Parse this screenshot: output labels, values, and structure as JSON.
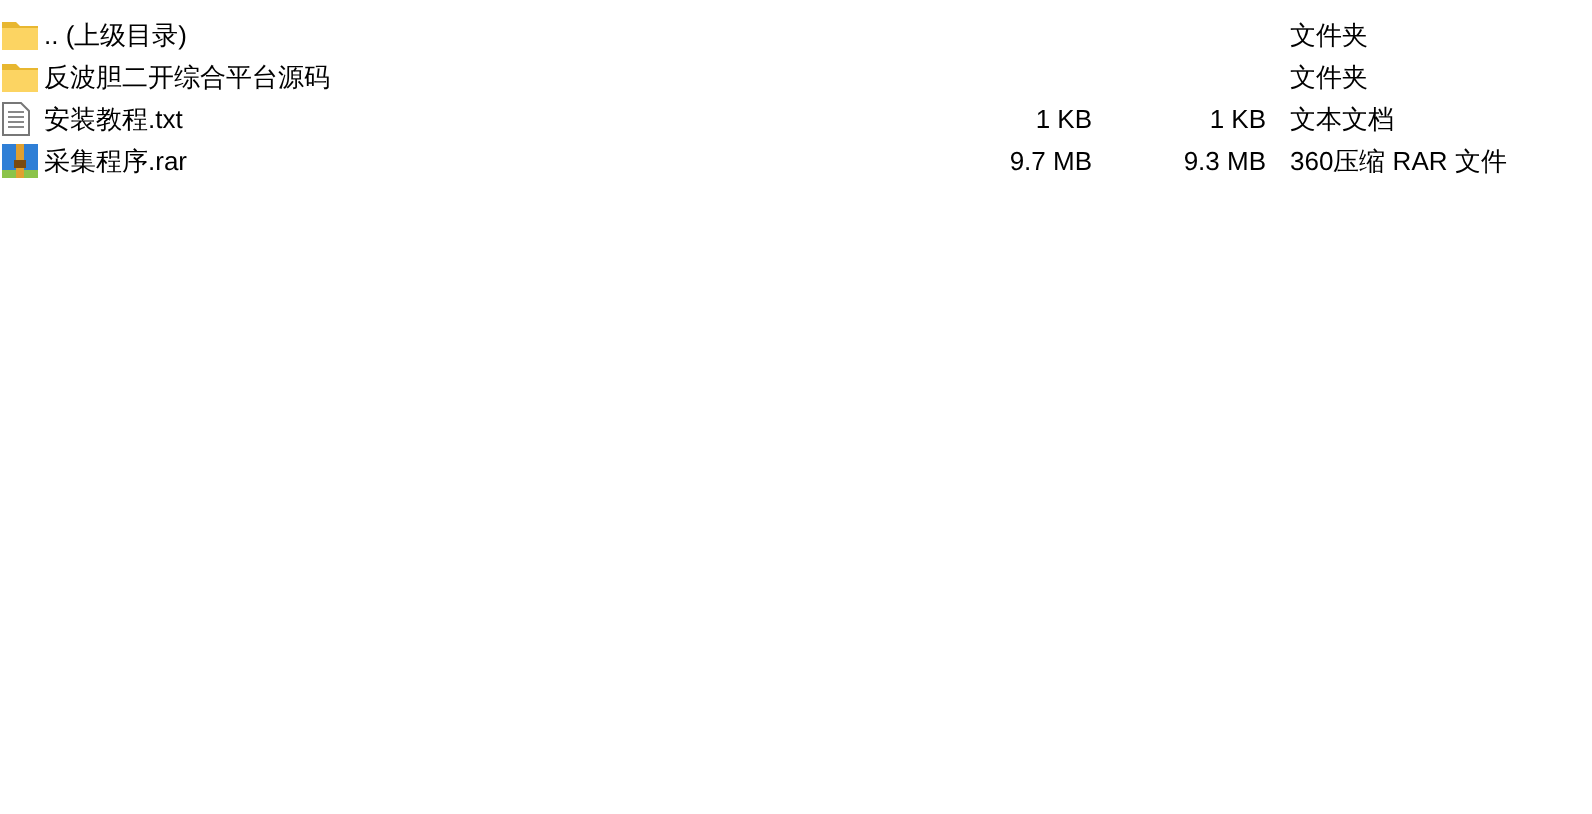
{
  "files": [
    {
      "kind": "folder",
      "name": ".. (上级目录)",
      "type": "文件夹"
    },
    {
      "kind": "folder",
      "name": "反波胆二开综合平台源码",
      "type": "文件夹"
    },
    {
      "kind": "text",
      "name": "安装教程.txt",
      "size": "1 KB",
      "packed": "1 KB",
      "type": "文本文档"
    },
    {
      "kind": "archive",
      "name": "采集程序.rar",
      "size": "9.7 MB",
      "packed": "9.3 MB",
      "type": "360压缩 RAR 文件"
    }
  ]
}
